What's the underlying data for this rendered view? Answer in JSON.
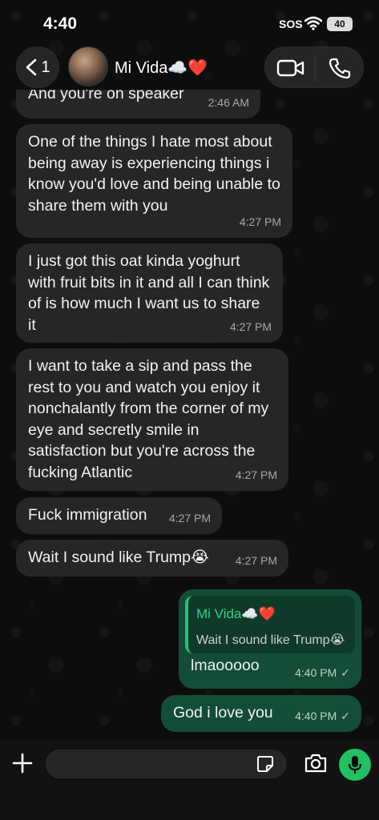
{
  "status_bar": {
    "time": "4:40",
    "sos": "SOS",
    "battery": "40"
  },
  "header": {
    "back_count": "1",
    "contact_name": "Mi Vida☁️❤️",
    "icons": [
      "back-chevron-icon",
      "video-call-icon",
      "phone-call-icon"
    ]
  },
  "messages": [
    {
      "direction": "incoming",
      "text": "And you're on speaker",
      "time": "2:46 AM"
    },
    {
      "direction": "incoming",
      "text": "One of the things I hate most about being away is experiencing things i know you'd love and being unable to share them with you",
      "time": "4:27 PM"
    },
    {
      "direction": "incoming",
      "text": "I just got this oat kinda yoghurt with fruit bits in it and all I can think of is how much I want us to share it",
      "time": "4:27 PM"
    },
    {
      "direction": "incoming",
      "text": "I want to take a sip and pass the rest to you and watch you enjoy it nonchalantly from the corner of my eye and secretly smile in satisfaction but you're across the fucking Atlantic",
      "time": "4:27 PM"
    },
    {
      "direction": "incoming",
      "text": "Fuck immigration",
      "time": "4:27 PM"
    },
    {
      "direction": "incoming",
      "text": "Wait I sound like Trump😭",
      "time": "4:27 PM"
    },
    {
      "direction": "outgoing",
      "quote_name": "Mi Vida☁️❤️",
      "quote_text": "Wait I sound like Trump😭",
      "text": "lmaooooo",
      "time": "4:40 PM",
      "status": "✓"
    },
    {
      "direction": "outgoing",
      "text": "God i love you",
      "time": "4:40 PM",
      "status": "✓"
    }
  ],
  "input_bar": {
    "value": "",
    "icons": [
      "plus-icon",
      "sticker-icon",
      "camera-icon",
      "microphone-icon"
    ]
  },
  "colors": {
    "incoming_bubble": "#262626",
    "outgoing_bubble": "#134d37",
    "accent_green": "#21c063"
  }
}
